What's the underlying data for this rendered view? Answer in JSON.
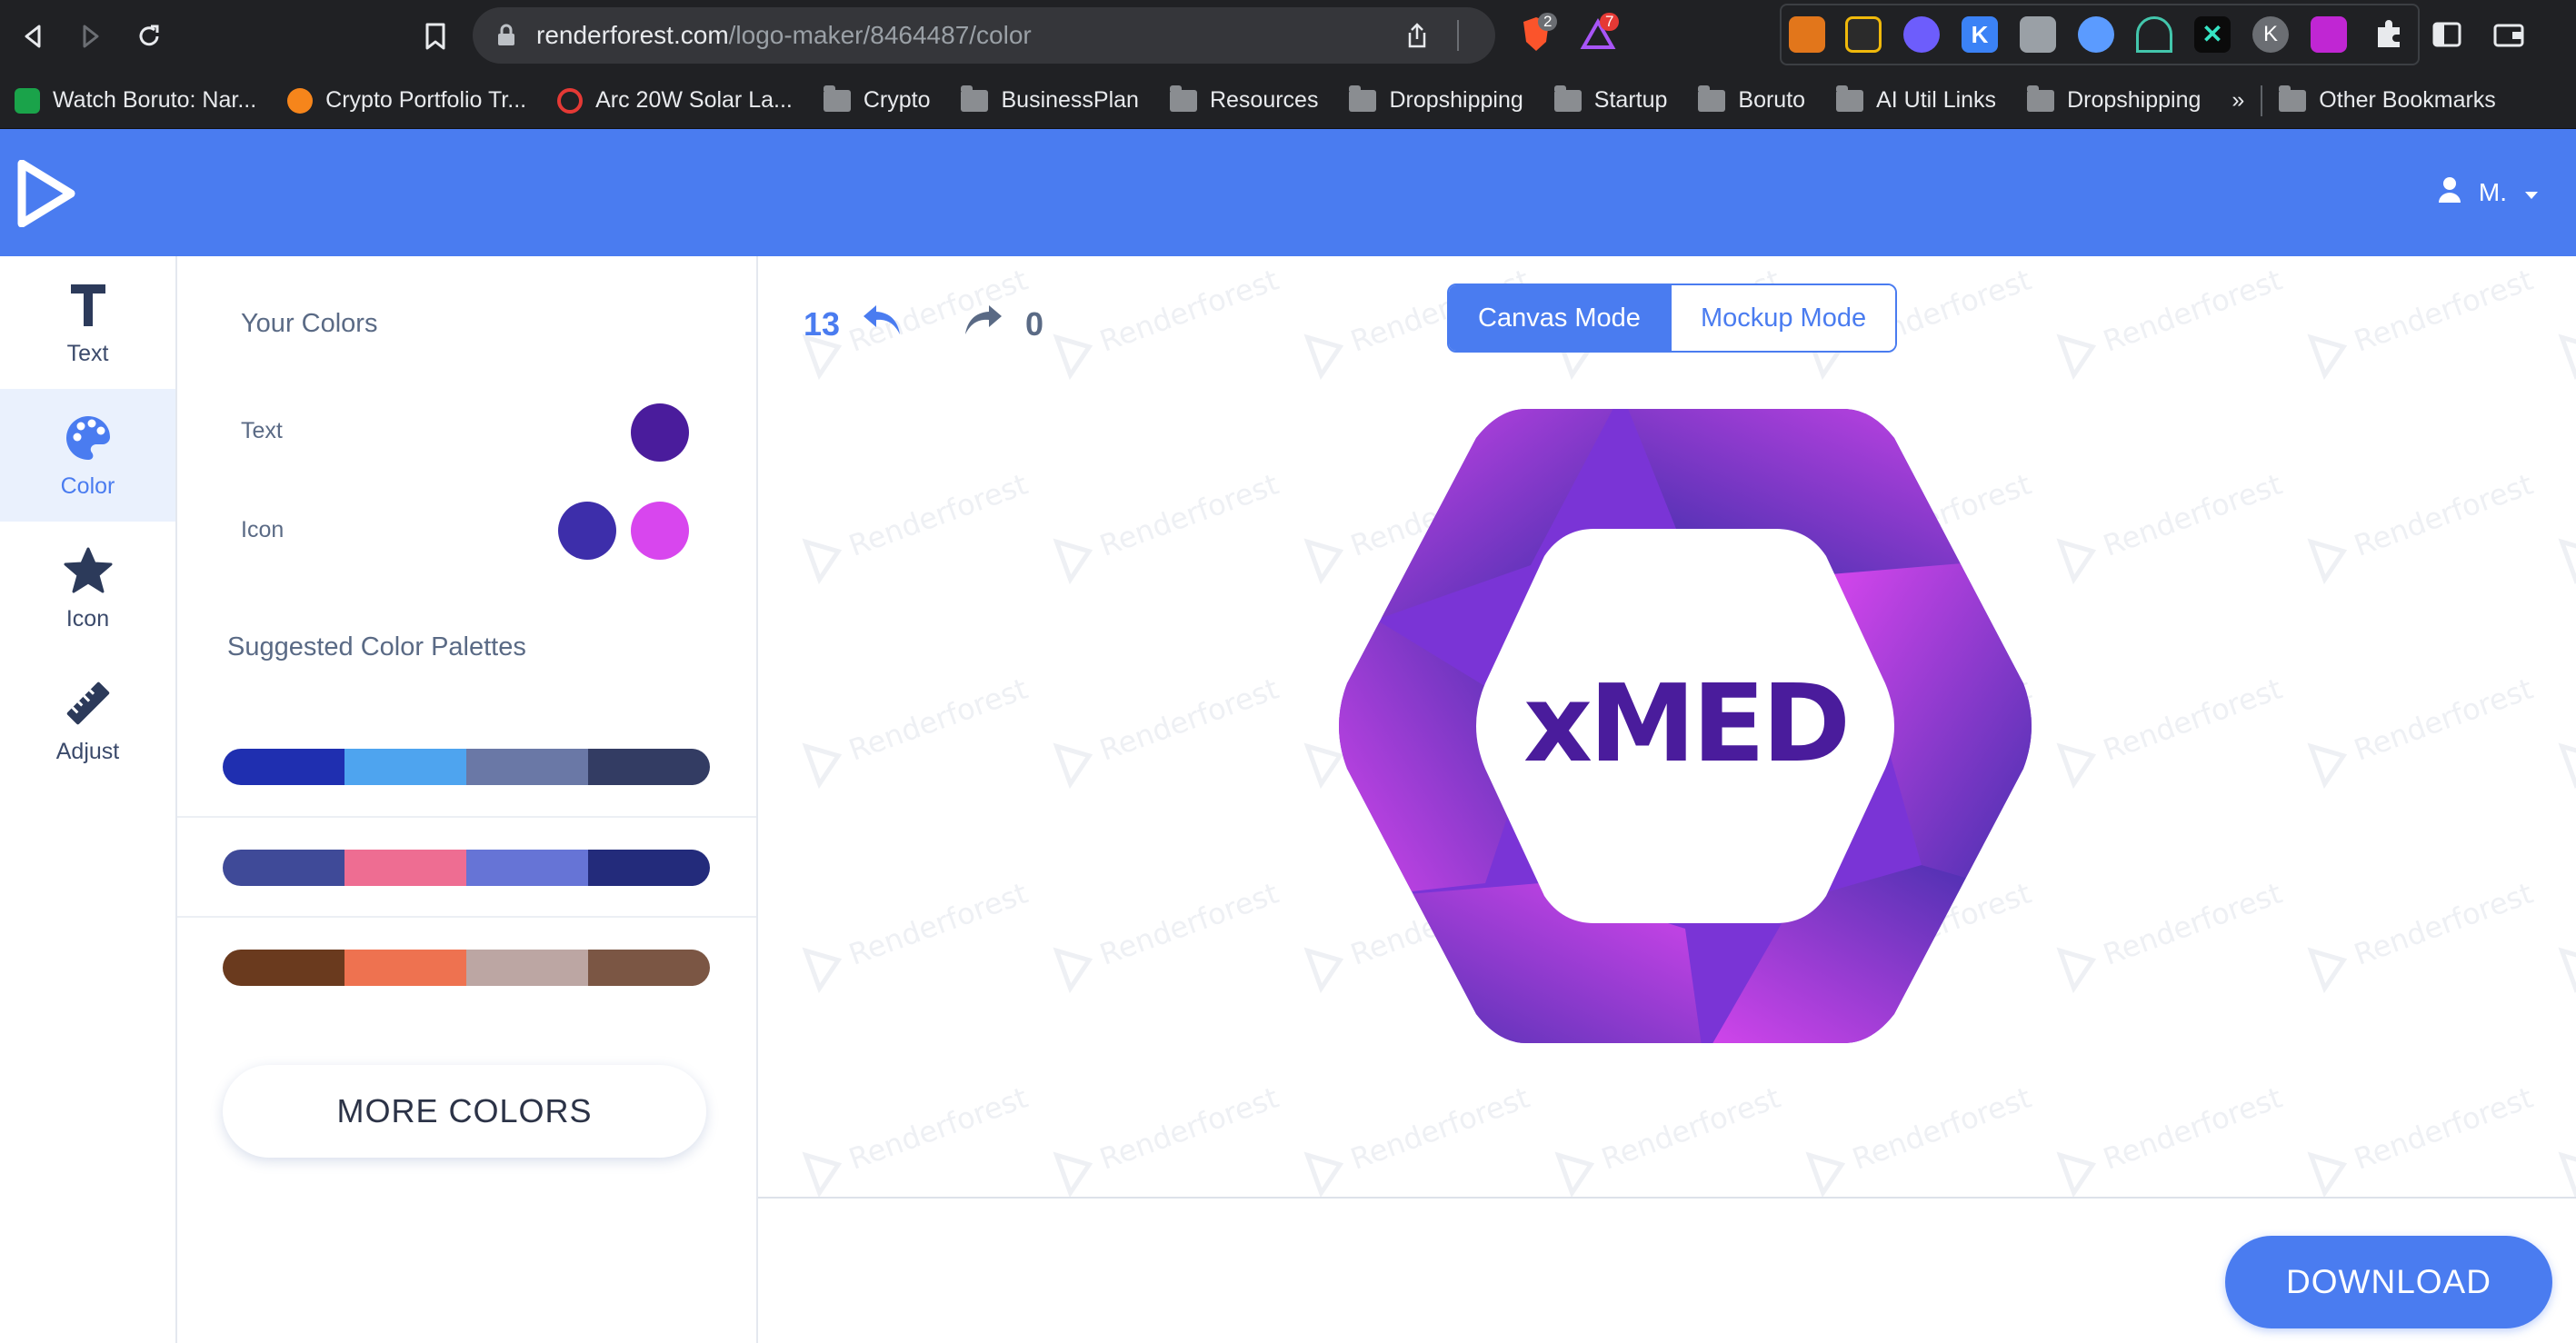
{
  "browser": {
    "url_host": "renderforest.com",
    "url_path": "/logo-maker/8464487/color",
    "brave_badge": "2",
    "alert_badge": "7",
    "ext_k_label": "K",
    "ext_k2_label": "K",
    "more_bookmarks": "»",
    "bookmarks": [
      {
        "label": "Watch Boruto: Nar...",
        "icon": "tv-favicon"
      },
      {
        "label": "Crypto Portfolio Tr...",
        "icon": "orange-favicon"
      },
      {
        "label": "Arc 20W Solar La...",
        "icon": "red-target-favicon"
      },
      {
        "label": "Crypto",
        "icon": "folder-icon"
      },
      {
        "label": "BusinessPlan",
        "icon": "folder-icon"
      },
      {
        "label": "Resources",
        "icon": "folder-icon"
      },
      {
        "label": "Dropshipping",
        "icon": "folder-icon"
      },
      {
        "label": "Startup",
        "icon": "folder-icon"
      },
      {
        "label": "Boruto",
        "icon": "folder-icon"
      },
      {
        "label": "AI Util Links",
        "icon": "folder-icon"
      },
      {
        "label": "Dropshipping",
        "icon": "folder-icon"
      }
    ],
    "other_bookmarks": "Other Bookmarks"
  },
  "header": {
    "user_name": "M."
  },
  "tools": [
    {
      "label": "Text",
      "icon": "text-t-icon"
    },
    {
      "label": "Color",
      "icon": "palette-icon"
    },
    {
      "label": "Icon",
      "icon": "star-icon"
    },
    {
      "label": "Adjust",
      "icon": "ruler-icon"
    }
  ],
  "color_panel": {
    "title": "Your Colors",
    "text_label": "Text",
    "icon_label": "Icon",
    "text_color": "#4a1c9c",
    "icon_colors": [
      "#3d2eaa",
      "#d846ee"
    ],
    "suggested_title": "Suggested Color Palettes",
    "palettes": [
      [
        "#1f2fb0",
        "#4ea4ef",
        "#6a78a6",
        "#333c63"
      ],
      [
        "#3f4a98",
        "#ee6d92",
        "#6674d6",
        "#232b7b"
      ],
      [
        "#6a3a1e",
        "#ee7250",
        "#bca6a3",
        "#7b5644"
      ]
    ],
    "more_colors_label": "MORE COLORS"
  },
  "canvas": {
    "undo_count": "13",
    "redo_count": "0",
    "mode_canvas": "Canvas Mode",
    "mode_mockup": "Mockup Mode",
    "logo_text": "xMED",
    "watermark_text": "Renderforest",
    "download_label": "DOWNLOAD"
  },
  "colors": {
    "accent": "#4a7cf0",
    "logo_magenta": "#d846ee",
    "logo_indigo": "#3d2eaa"
  }
}
